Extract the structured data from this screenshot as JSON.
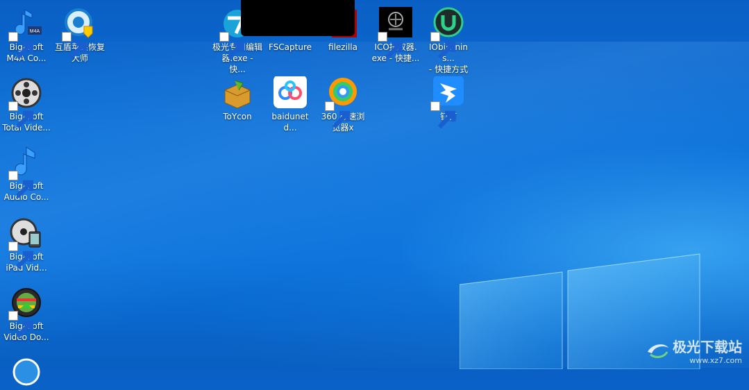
{
  "desktop": {
    "icons": [
      {
        "id": "m4a",
        "line1": "Bigasoft",
        "line2": "M4A Co..."
      },
      {
        "id": "hudun",
        "line1": "互盾苹果恢复",
        "line2": "大师"
      },
      {
        "id": "total",
        "line1": "Bigasoft",
        "line2": "Total Vide..."
      },
      {
        "id": "audio",
        "line1": "Bigasoft",
        "line2": "Audio Co..."
      },
      {
        "id": "ipad",
        "line1": "Bigasoft",
        "line2": "iPad Vid..."
      },
      {
        "id": "download",
        "line1": "Bigasoft",
        "line2": "Video Do..."
      },
      {
        "id": "jiguang",
        "line1": "极光专用编辑",
        "line2": "器.exe - 快..."
      },
      {
        "id": "fscapture",
        "line1": "FSCapture",
        "line2": ""
      },
      {
        "id": "filezilla",
        "line1": "filezilla",
        "line2": ""
      },
      {
        "id": "ico",
        "line1": "ICO提取器.",
        "line2": "exe - 快捷..."
      },
      {
        "id": "iobit",
        "line1": "IObitUnins...",
        "line2": "- 快捷方式"
      },
      {
        "id": "toycon",
        "line1": "ToYcon",
        "line2": ""
      },
      {
        "id": "baidu",
        "line1": "baidunetd...",
        "line2": ""
      },
      {
        "id": "browser360",
        "line1": "360 极速浏",
        "line2": "览器x"
      },
      {
        "id": "dingding",
        "line1": "钉钉",
        "line2": ""
      }
    ]
  },
  "watermark": {
    "text": "极光下载站",
    "url": "www.xz7.com"
  },
  "colors": {
    "background": "#0b6fd6"
  }
}
